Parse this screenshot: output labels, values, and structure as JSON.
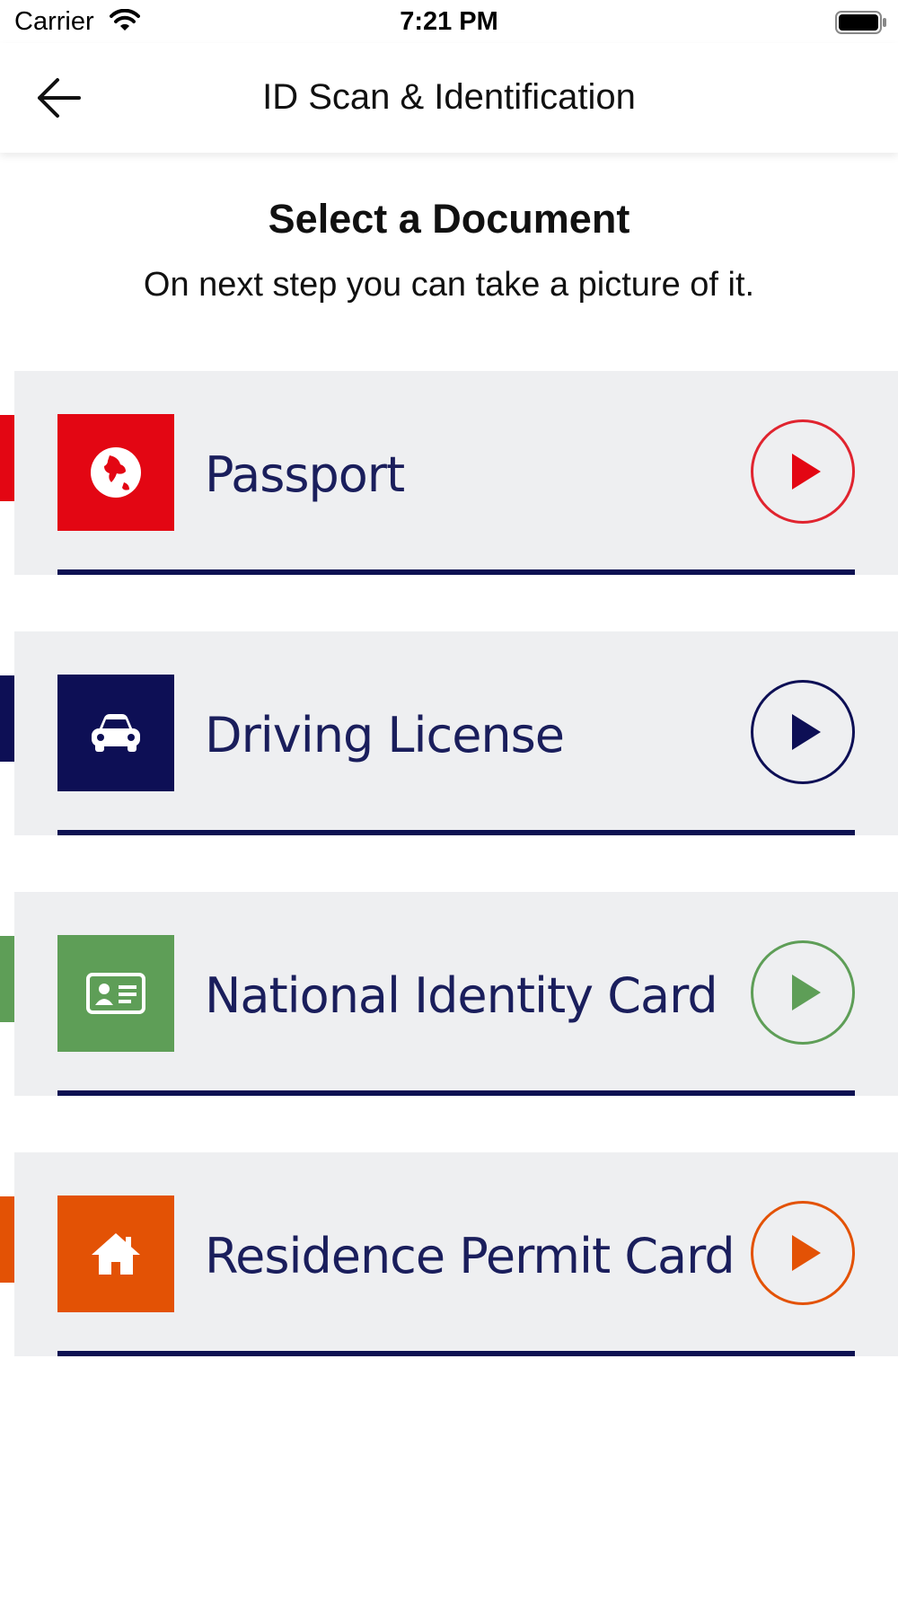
{
  "status_bar": {
    "carrier": "Carrier",
    "time": "7:21 PM",
    "icons": [
      "wifi-icon",
      "battery-icon"
    ]
  },
  "header": {
    "title": "ID Scan & Identification",
    "back_icon": "arrow-left-icon"
  },
  "main": {
    "title": "Select a Document",
    "subtitle": "On next step you can take a picture of it."
  },
  "documents": [
    {
      "label": "Passport",
      "icon": "globe-icon",
      "color": "#e30613",
      "arrow_color": "#e0242f"
    },
    {
      "label": "Driving License",
      "icon": "car-icon",
      "color": "#0d0f55",
      "arrow_color": "#0d0f55"
    },
    {
      "label": "National Identity Card",
      "icon": "id-card-icon",
      "color": "#5e9e57",
      "arrow_color": "#5e9e57"
    },
    {
      "label": "Residence Permit Card",
      "icon": "home-icon",
      "color": "#e35205",
      "arrow_color": "#e35205"
    }
  ],
  "colors": {
    "card_background": "#eeeff1",
    "underline": "#0d1152",
    "label_text": "#1a1e5c"
  }
}
